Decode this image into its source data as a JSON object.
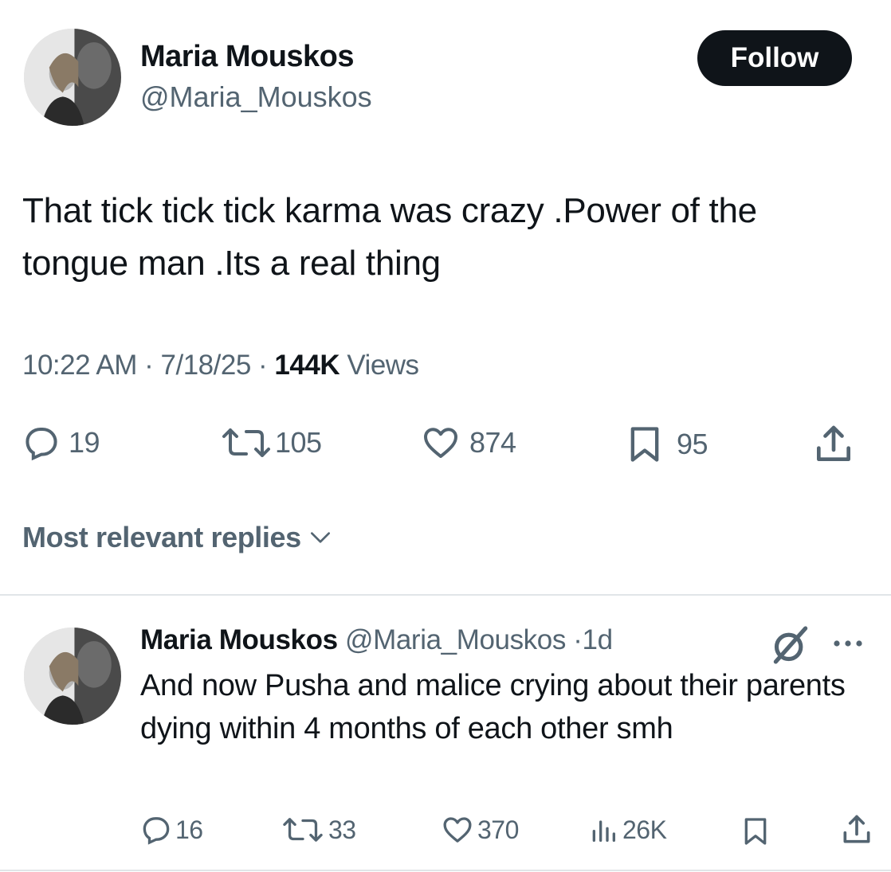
{
  "tweet": {
    "author_name": "Maria Mouskos",
    "author_handle": "@Maria_Mouskos",
    "follow_label": "Follow",
    "text": "That tick tick tick karma was crazy .Power of the tongue man .Its a real thing",
    "time": "10:22 AM",
    "date": "7/18/25",
    "separator": "·",
    "views_count": "144K",
    "views_label": "Views",
    "stats": {
      "replies": "19",
      "reposts": "105",
      "likes": "874",
      "bookmarks": "95"
    }
  },
  "replies_sort": {
    "label": "Most relevant replies"
  },
  "reply": {
    "author_name": "Maria Mouskos",
    "author_handle": "@Maria_Mouskos",
    "time_prefix": "·",
    "time": "1d",
    "text": "And now Pusha and malice crying about their parents dying within 4 months of each other smh",
    "stats": {
      "replies": "16",
      "reposts": "33",
      "likes": "370",
      "views": "26K"
    }
  },
  "colors": {
    "text_primary": "#0f1419",
    "text_secondary": "#536471",
    "button_bg": "#0f1419",
    "divider": "#e1e5e8"
  },
  "icons": [
    "reply-icon",
    "repost-icon",
    "like-icon",
    "bookmark-icon",
    "share-icon",
    "chevron-down-icon",
    "grok-icon",
    "more-icon",
    "views-icon"
  ]
}
